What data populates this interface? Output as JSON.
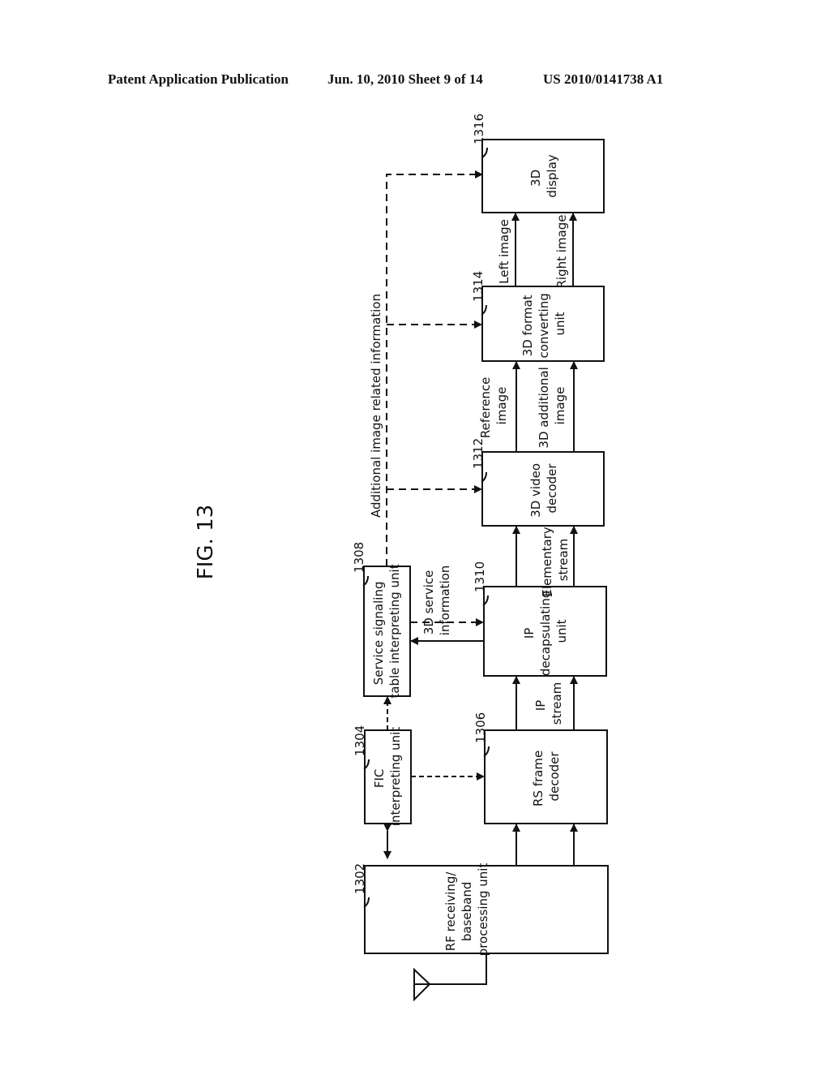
{
  "header": {
    "left": "Patent Application Publication",
    "middle": "Jun. 10, 2010  Sheet 9 of 14",
    "right": "US 2010/0141738 A1"
  },
  "figure": {
    "title": "FIG. 13",
    "blocks": [
      {
        "id": "1302",
        "ref": "1302",
        "lines": [
          "RF receiving/",
          "baseband",
          "processing unit"
        ]
      },
      {
        "id": "1304",
        "ref": "1304",
        "lines": [
          "FIC",
          "interpreting unit"
        ]
      },
      {
        "id": "1306",
        "ref": "1306",
        "lines": [
          "RS frame",
          "decoder"
        ]
      },
      {
        "id": "1308",
        "ref": "1308",
        "lines": [
          "Service signaling",
          "table interpreting unit"
        ]
      },
      {
        "id": "1310",
        "ref": "1310",
        "lines": [
          "IP",
          "decapsulating",
          "unit"
        ]
      },
      {
        "id": "1312",
        "ref": "1312",
        "lines": [
          "3D video",
          "decoder"
        ]
      },
      {
        "id": "1314",
        "ref": "1314",
        "lines": [
          "3D format",
          "converting",
          "unit"
        ]
      },
      {
        "id": "1316",
        "ref": "1316",
        "lines": [
          "3D",
          "display"
        ]
      }
    ],
    "edge_labels": {
      "ip_stream": [
        "IP",
        "stream"
      ],
      "elementary_stream": [
        "Elementary",
        "stream"
      ],
      "reference_image": [
        "Reference",
        "image"
      ],
      "additional_image": [
        "3D additional",
        "image"
      ],
      "left_image": "Left image",
      "right_image": "Right image",
      "service_info": [
        "3D service",
        "information"
      ],
      "additional_info": "Additional image related information"
    }
  }
}
